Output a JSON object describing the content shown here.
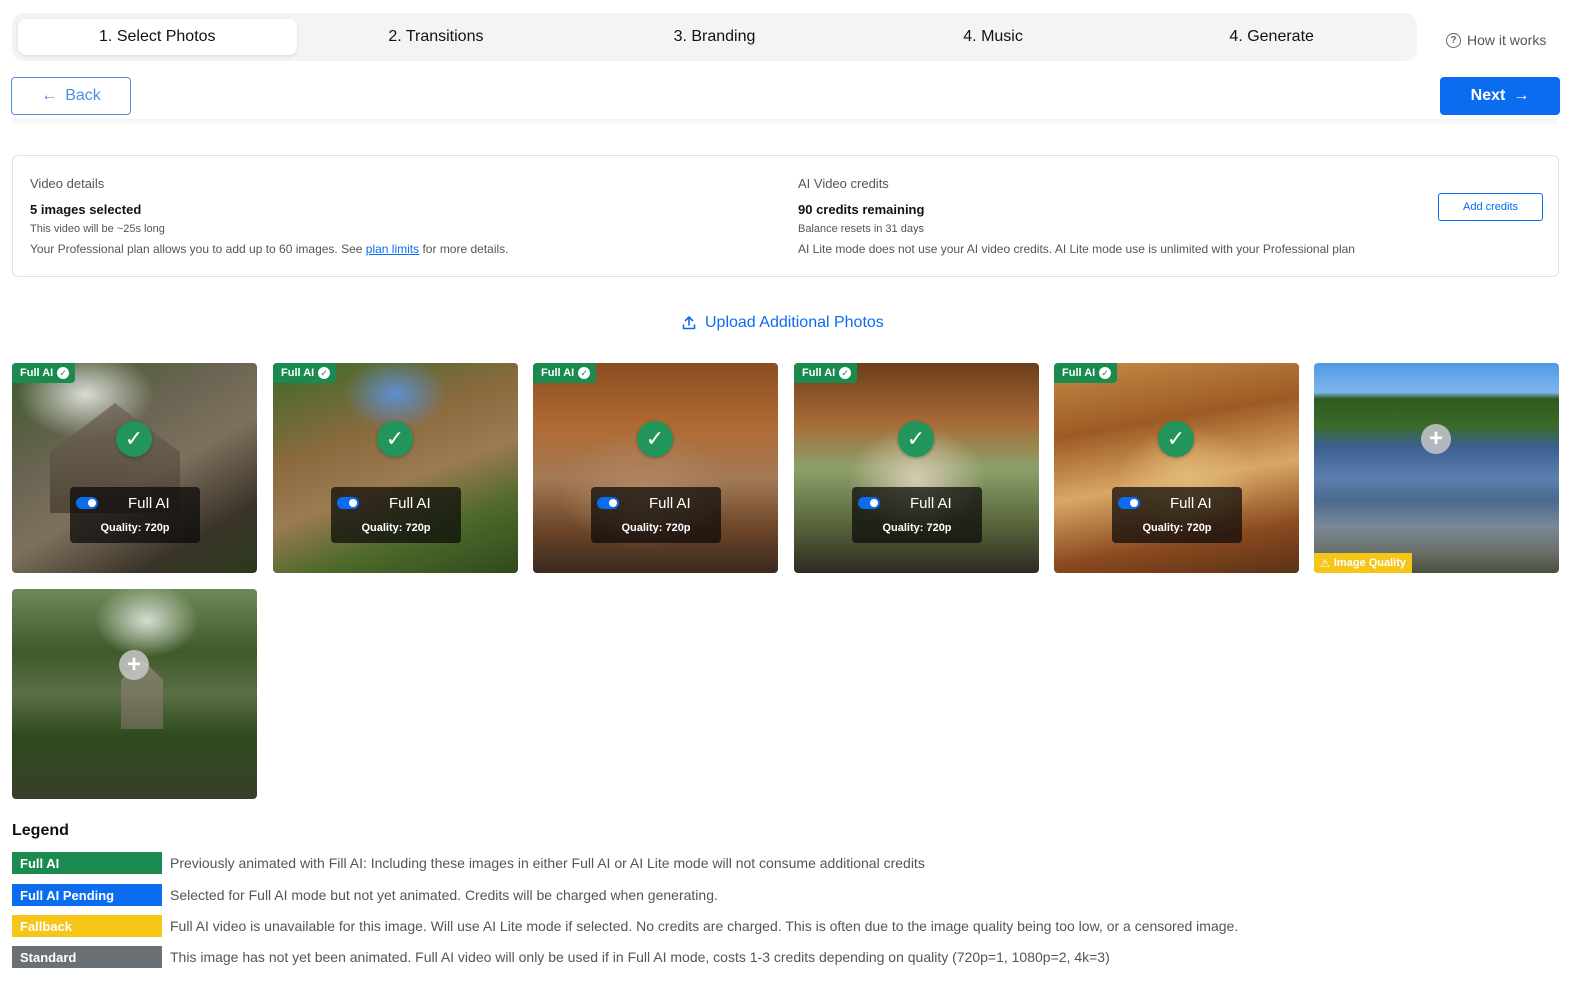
{
  "stepper": {
    "steps": [
      "1. Select Photos",
      "2. Transitions",
      "3. Branding",
      "4. Music",
      "4. Generate"
    ],
    "active_index": 0,
    "help_label": "How it works"
  },
  "nav": {
    "back_label": "Back",
    "next_label": "Next"
  },
  "details": {
    "video_label": "Video details",
    "images_selected": "5 images selected",
    "length_note": "This video will be ~25s long",
    "plan_note_prefix": "Your Professional plan allows you to add up to 60 images. See ",
    "plan_link": "plan limits",
    "plan_note_suffix": " for more details.",
    "credits_label": "AI Video credits",
    "credits_remaining": "90 credits remaining",
    "reset_note": "Balance resets in 31 days",
    "lite_note": "AI Lite mode does not use your AI video credits. AI Lite mode use is unlimited with your Professional plan",
    "add_credits_label": "Add credits"
  },
  "upload_label": "Upload Additional Photos",
  "photos": [
    {
      "badge": "Full AI",
      "selected": true,
      "mode_label": "Full AI",
      "quality": "Quality: 720p",
      "scene": "cabin exterior"
    },
    {
      "badge": "Full AI",
      "selected": true,
      "mode_label": "Full AI",
      "quality": "Quality: 720p",
      "scene": "cabin entrance"
    },
    {
      "badge": "Full AI",
      "selected": true,
      "mode_label": "Full AI",
      "quality": "Quality: 720p",
      "scene": "living room"
    },
    {
      "badge": "Full AI",
      "selected": true,
      "mode_label": "Full AI",
      "quality": "Quality: 720p",
      "scene": "sunroom"
    },
    {
      "badge": "Full AI",
      "selected": true,
      "mode_label": "Full AI",
      "quality": "Quality: 720p",
      "scene": "loft overhead"
    },
    {
      "badge": "",
      "selected": false,
      "warning": "Image Quality",
      "scene": "lake view"
    },
    {
      "badge": "",
      "selected": false,
      "scene": "gazebo in forest"
    }
  ],
  "legend": {
    "title": "Legend",
    "items": [
      {
        "label": "Full AI",
        "color": "#1a8a4e",
        "text": "Previously animated with Fill AI: Including these images in either Full AI or AI Lite mode will not consume additional credits"
      },
      {
        "label": "Full AI Pending",
        "color": "#0b6cf0",
        "text": "Selected for Full AI mode but not yet animated. Credits will be charged when generating."
      },
      {
        "label": "Fallback",
        "color": "#f5c518",
        "text": "Full AI video is unavailable for this image. Will use AI Lite mode if selected. No credits are charged. This is often due to the image quality being too low, or a censored image."
      },
      {
        "label": "Standard",
        "color": "#6b7075",
        "text": "This image has not yet been animated. Full AI video will only be used if in Full AI mode, costs 1-3 credits depending on quality (720p=1, 1080p=2, 4k=3)"
      }
    ]
  }
}
